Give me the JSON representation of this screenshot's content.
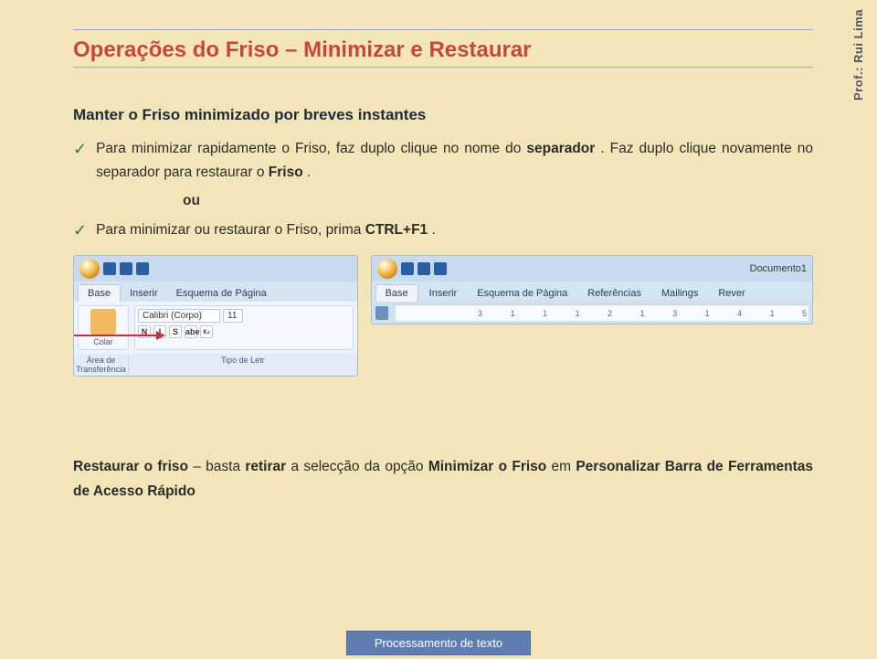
{
  "meta": {
    "author": "Prof.: Rui Lima"
  },
  "title": "Operações do Friso – Minimizar e Restaurar",
  "subtitle": "Manter o Friso minimizado por breves instantes",
  "bullets": [
    {
      "a": "Para minimizar rapidamente o Friso, faz duplo clique no nome do ",
      "b": "separador",
      "c": ". Faz duplo clique novamente no separador para restaurar o ",
      "d": "Friso",
      "e": "."
    },
    {
      "a": "Para minimizar ou restaurar o Friso, prima ",
      "b": "CTRL+F1",
      "c": "."
    }
  ],
  "or_label": "ou",
  "shot1": {
    "tabs": [
      "Base",
      "Inserir",
      "Esquema de Página"
    ],
    "groups": {
      "paste": "Colar"
    },
    "font_name": "Calibri (Corpo)",
    "font_size": "11",
    "buttons": [
      "N",
      "I",
      "S",
      "abe",
      "x₂"
    ],
    "group_labels": [
      "Área de Transferência",
      "Tipo de Letr"
    ]
  },
  "shot2": {
    "doc_title": "Documento1",
    "tabs": [
      "Base",
      "Inserir",
      "Esquema de Página",
      "Referências",
      "Mailings",
      "Rever"
    ],
    "ruler": "3 1 1 1 2 1 3 1 4 1 5"
  },
  "restore": {
    "a": "Restaurar o friso",
    "b": " – basta ",
    "c": "retirar",
    "d": " a selecção da opção ",
    "e": "Minimizar o Friso",
    "f": " em ",
    "g": "Personalizar Barra de Ferramentas de Acesso Rápido"
  },
  "footer": "Processamento de texto"
}
